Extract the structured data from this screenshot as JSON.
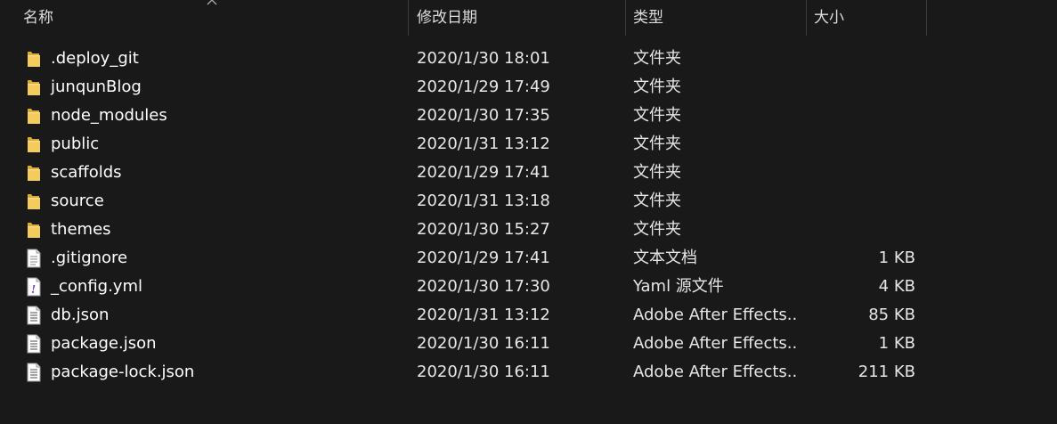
{
  "columns": {
    "name": "名称",
    "modified": "修改日期",
    "type": "类型",
    "size": "大小"
  },
  "files": [
    {
      "name": ".deploy_git",
      "modified": "2020/1/30 18:01",
      "type": "文件夹",
      "size": "",
      "icon": "folder-icon"
    },
    {
      "name": "junqunBlog",
      "modified": "2020/1/29 17:49",
      "type": "文件夹",
      "size": "",
      "icon": "folder-icon"
    },
    {
      "name": "node_modules",
      "modified": "2020/1/30 17:35",
      "type": "文件夹",
      "size": "",
      "icon": "folder-icon"
    },
    {
      "name": "public",
      "modified": "2020/1/31 13:12",
      "type": "文件夹",
      "size": "",
      "icon": "folder-icon"
    },
    {
      "name": "scaffolds",
      "modified": "2020/1/29 17:41",
      "type": "文件夹",
      "size": "",
      "icon": "folder-icon"
    },
    {
      "name": "source",
      "modified": "2020/1/31 13:18",
      "type": "文件夹",
      "size": "",
      "icon": "folder-icon"
    },
    {
      "name": "themes",
      "modified": "2020/1/30 15:27",
      "type": "文件夹",
      "size": "",
      "icon": "folder-icon"
    },
    {
      "name": ".gitignore",
      "modified": "2020/1/29 17:41",
      "type": "文本文档",
      "size": "1 KB",
      "icon": "text-document-icon"
    },
    {
      "name": "_config.yml",
      "modified": "2020/1/30 17:30",
      "type": "Yaml 源文件",
      "size": "4 KB",
      "icon": "yaml-file-icon"
    },
    {
      "name": "db.json",
      "modified": "2020/1/31 13:12",
      "type": "Adobe After Effects...",
      "size": "85 KB",
      "icon": "json-file-icon"
    },
    {
      "name": "package.json",
      "modified": "2020/1/30 16:11",
      "type": "Adobe After Effects...",
      "size": "1 KB",
      "icon": "json-file-icon"
    },
    {
      "name": "package-lock.json",
      "modified": "2020/1/30 16:11",
      "type": "Adobe After Effects...",
      "size": "211 KB",
      "icon": "json-file-icon"
    }
  ]
}
